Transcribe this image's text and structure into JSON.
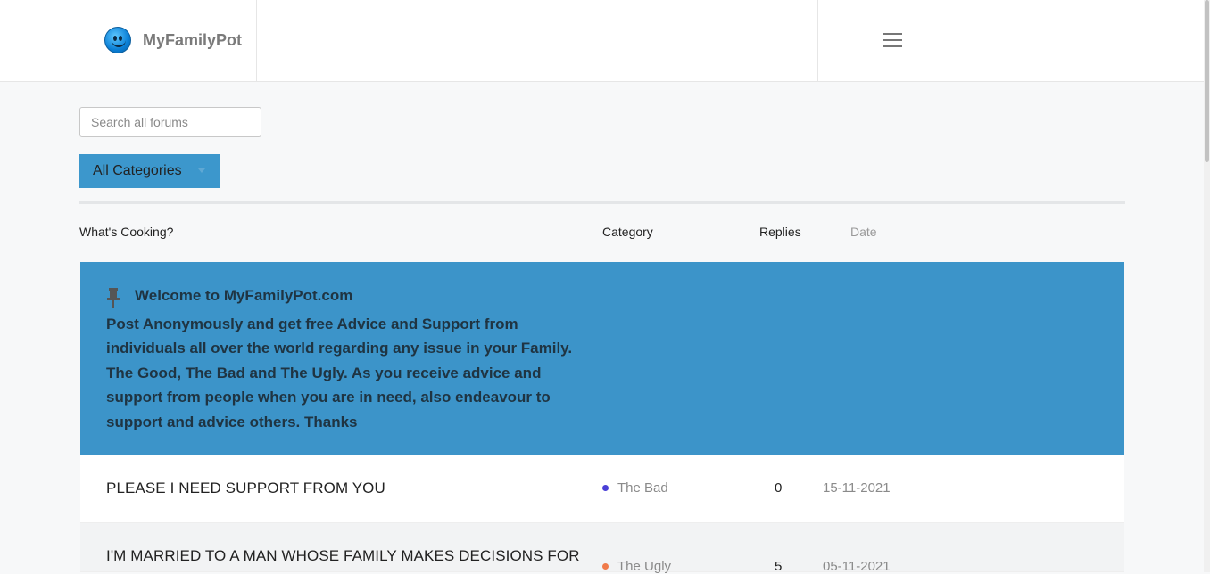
{
  "header": {
    "brand_name": "MyFamilyPot",
    "logo_icon": "smiley-face-icon",
    "menu_icon": "hamburger-menu-icon"
  },
  "search": {
    "placeholder": "Search all forums",
    "value": ""
  },
  "filter": {
    "selected": "All Categories",
    "accent_color": "#3c97cc"
  },
  "table": {
    "headers": {
      "topic": "What's Cooking?",
      "category": "Category",
      "replies": "Replies",
      "date": "Date"
    },
    "pinned": {
      "icon": "pushpin-icon",
      "title": "Welcome to MyFamilyPot.com",
      "body": "Post Anonymously and get free Advice and Support from individuals all over the world regarding any issue in your Family. The Good, The Bad and The Ugly. As you receive advice and support from people when you are in need, also endeavour to support and advice others. Thanks",
      "background": "#3c94c9"
    },
    "rows": [
      {
        "title": "PLEASE I NEED SUPPORT FROM YOU",
        "category": "The Bad",
        "category_color": "#4a3fd6",
        "replies": "0",
        "date": "15-11-2021"
      },
      {
        "title": "I'M MARRIED TO A MAN WHOSE FAMILY MAKES DECISIONS FOR",
        "category": "The Ugly",
        "category_color": "#f07a4a",
        "replies": "5",
        "date": "05-11-2021"
      }
    ]
  }
}
